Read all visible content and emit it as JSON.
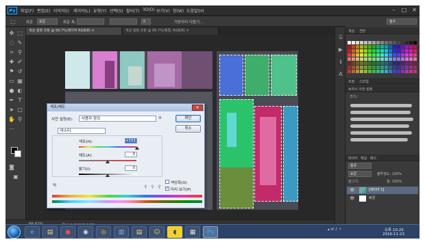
{
  "menubar": {
    "logo": "Ps",
    "items": [
      "파일(F)",
      "편집(E)",
      "이미지(I)",
      "레이어(L)",
      "유형(Y)",
      "선택(S)",
      "필터(T)",
      "3D(D)",
      "보기(V)",
      "창(W)",
      "도움말(H)"
    ],
    "window_controls": [
      "–",
      "□",
      "✕"
    ]
  },
  "optionsbar": {
    "style_label": "표준",
    "width_label": "표준 폭:",
    "width_value": "",
    "height_value": "",
    "feather_value": "0",
    "refine_label": "가장자리 다듬기..."
  },
  "tabs": [
    {
      "label": "색상 설정 조정 @ 66.7%(레이어 RGB/8) ✕",
      "active": true
    },
    {
      "label": "색상 설정 조정 @ 66.7%(배경, RGB/8) ✕",
      "active": false
    }
  ],
  "right_panel": {
    "workspace": "필수",
    "color_tabs": [
      "색상",
      "견본"
    ],
    "adjust_tabs": [
      "조정",
      "스타일"
    ],
    "brush_tab": "브러시 사전 설정",
    "size_label": "크기:",
    "layer_tabs": [
      "레이어",
      "채널",
      "패스"
    ],
    "kind_label": "종류",
    "blend_label": "표준",
    "opacity_label": "불투명도: 100%",
    "lock_label": "잠그기:",
    "fill_label": "칠: 100%",
    "layers": [
      {
        "name": "[레이어 1]",
        "selected": true
      },
      {
        "name": "배경",
        "selected": false
      }
    ]
  },
  "statusbar": {
    "zoom": "66.67%",
    "doc_info": "문서:2.61M/6.12M"
  },
  "dialog": {
    "title": "색조/채도",
    "close": "✕",
    "preset_label": "사전 설정(E):",
    "preset_value": "사용자 정의",
    "channel_value": "마스터",
    "hue_label": "색조(H):",
    "hue_value": "+151",
    "saturation_label": "채도(A):",
    "saturation_value": "0",
    "lightness_label": "밝기(I):",
    "lightness_value": "0",
    "ok_button": "확인",
    "cancel_button": "취소",
    "colorize_label": "색상화(O)",
    "preview_label": "미리 보기(P)",
    "preview_checked": true,
    "colorize_checked": false,
    "hand_tool": "덕"
  },
  "taskbar": {
    "tray_time": "오후 10:25",
    "tray_date": "2016-11-23"
  },
  "colors": {
    "accent": "#3b77c6",
    "ps_blue": "#31a8ff",
    "selected_layer": "#5a6b80"
  }
}
